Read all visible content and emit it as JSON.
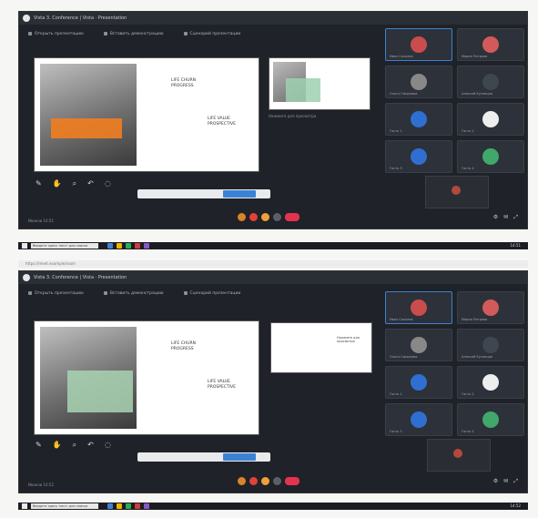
{
  "window": {
    "title": "Vista 3. Conference | Vista · Presentation",
    "url": "https://meet.example/room"
  },
  "tabs": [
    "Открыть презентацию",
    "Вставить демонстрацию",
    "Сценарий презентации"
  ],
  "screens": [
    {
      "id": "top",
      "slide_title": "LIFE CHURN\nPROGRESS",
      "slide_subtitle": "LIFE VALUE\nPROSPECTIVE",
      "side_caption": "Нажмите для просмотра",
      "status_left": "Иванов 14:51",
      "participants": [
        "Иван Соколов",
        "Мария Петрова",
        "Ольга Смирнова",
        "Алексей Кузнецов",
        "Гость 1",
        "Гость 2",
        "Гость 3",
        "Гость 4"
      ]
    },
    {
      "id": "bottom",
      "slide_title": "LIFE CHURN\nPROGRESS",
      "slide_subtitle": "LIFE VALUE\nPROSPECTIVE",
      "side_caption": "Нажмите для просмотра",
      "status_left": "Иванов 14:52",
      "participants": [
        "Иван Соколов",
        "Мария Петрова",
        "Ольга Смирнова",
        "Алексей Кузнецов",
        "Гость 1",
        "Гость 2",
        "Гость 3",
        "Гость 4"
      ]
    }
  ],
  "taskbar": {
    "search_placeholder": "Введите здесь текст для поиска",
    "clock_top": "14:51",
    "clock_bottom": "14:52"
  },
  "colors": {
    "app_bg": "#1f2228",
    "accent": "#3b82d6",
    "slide_orange": "#ef7d22",
    "slide_green": "#a8d4b2"
  }
}
